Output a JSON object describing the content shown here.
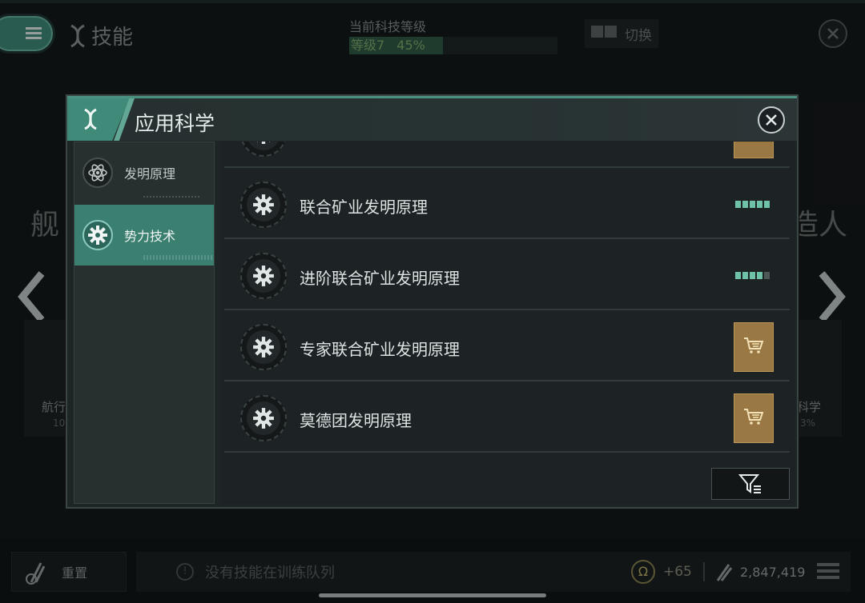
{
  "header": {
    "title": "技能",
    "tech_level_label": "当前科技等级",
    "tech_level_value": "等级7",
    "tech_level_percent": "45%",
    "tech_level_progress": 0.45,
    "switch_label": "切换"
  },
  "background": {
    "left_text": "舰",
    "right_text": "造人",
    "left_card_title": "航行",
    "left_card_sub": "10",
    "right_card_title": "科学",
    "right_card_sub": "3%"
  },
  "modal": {
    "title": "应用科学",
    "sidebar": [
      {
        "label": "发明原理",
        "icon": "atom-icon"
      },
      {
        "label": "势力技术",
        "icon": "gear-icon"
      }
    ],
    "rows": [
      {
        "name": "",
        "status": "cart"
      },
      {
        "name": "联合矿业发明原理",
        "status": "level",
        "level": 5,
        "max": 5
      },
      {
        "name": "进阶联合矿业发明原理",
        "status": "level",
        "level": 4,
        "max": 5
      },
      {
        "name": "专家联合矿业发明原理",
        "status": "cart"
      },
      {
        "name": "莫德团发明原理",
        "status": "cart"
      }
    ]
  },
  "footer": {
    "reset_label": "重置",
    "queue_message": "没有技能在训练队列",
    "omega_value": "+65",
    "isk_value": "2,847,419"
  },
  "colors": {
    "accent": "#3f8a79",
    "cart": "#9a7843",
    "pip_on": "#6fc2a7",
    "pip_off": "#4e5857"
  }
}
